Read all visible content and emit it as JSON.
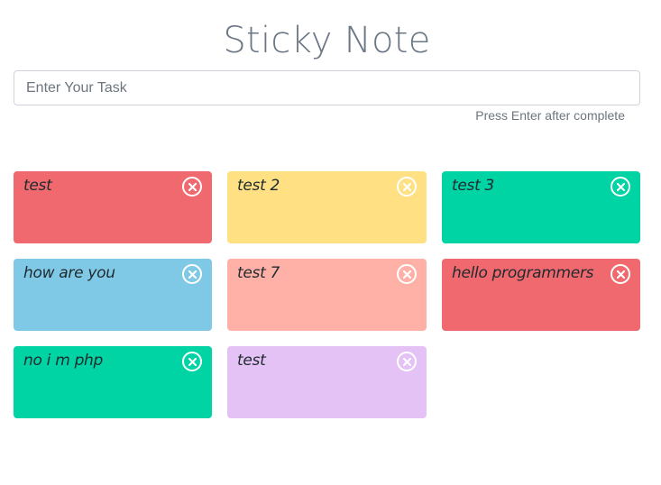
{
  "header": {
    "title": "Sticky Note"
  },
  "task_input": {
    "placeholder": "Enter Your Task",
    "value": "",
    "hint": "Press Enter after complete"
  },
  "notes": [
    {
      "text": "test",
      "color": "#f0696f",
      "close_icon": "close-circle-icon"
    },
    {
      "text": "test 2",
      "color": "#ffe082",
      "close_icon": "close-circle-icon"
    },
    {
      "text": "test 3",
      "color": "#00d4a4",
      "close_icon": "close-circle-icon"
    },
    {
      "text": "how are you",
      "color": "#80c9e6",
      "close_icon": "close-circle-icon"
    },
    {
      "text": "test 7",
      "color": "#ffb1a8",
      "close_icon": "close-circle-icon"
    },
    {
      "text": "hello programmers",
      "color": "#f0696f",
      "close_icon": "close-circle-icon"
    },
    {
      "text": "no i m php",
      "color": "#00d4a4",
      "close_icon": "close-circle-icon"
    },
    {
      "text": "test",
      "color": "#e4c2f5",
      "close_icon": "close-circle-icon"
    }
  ]
}
